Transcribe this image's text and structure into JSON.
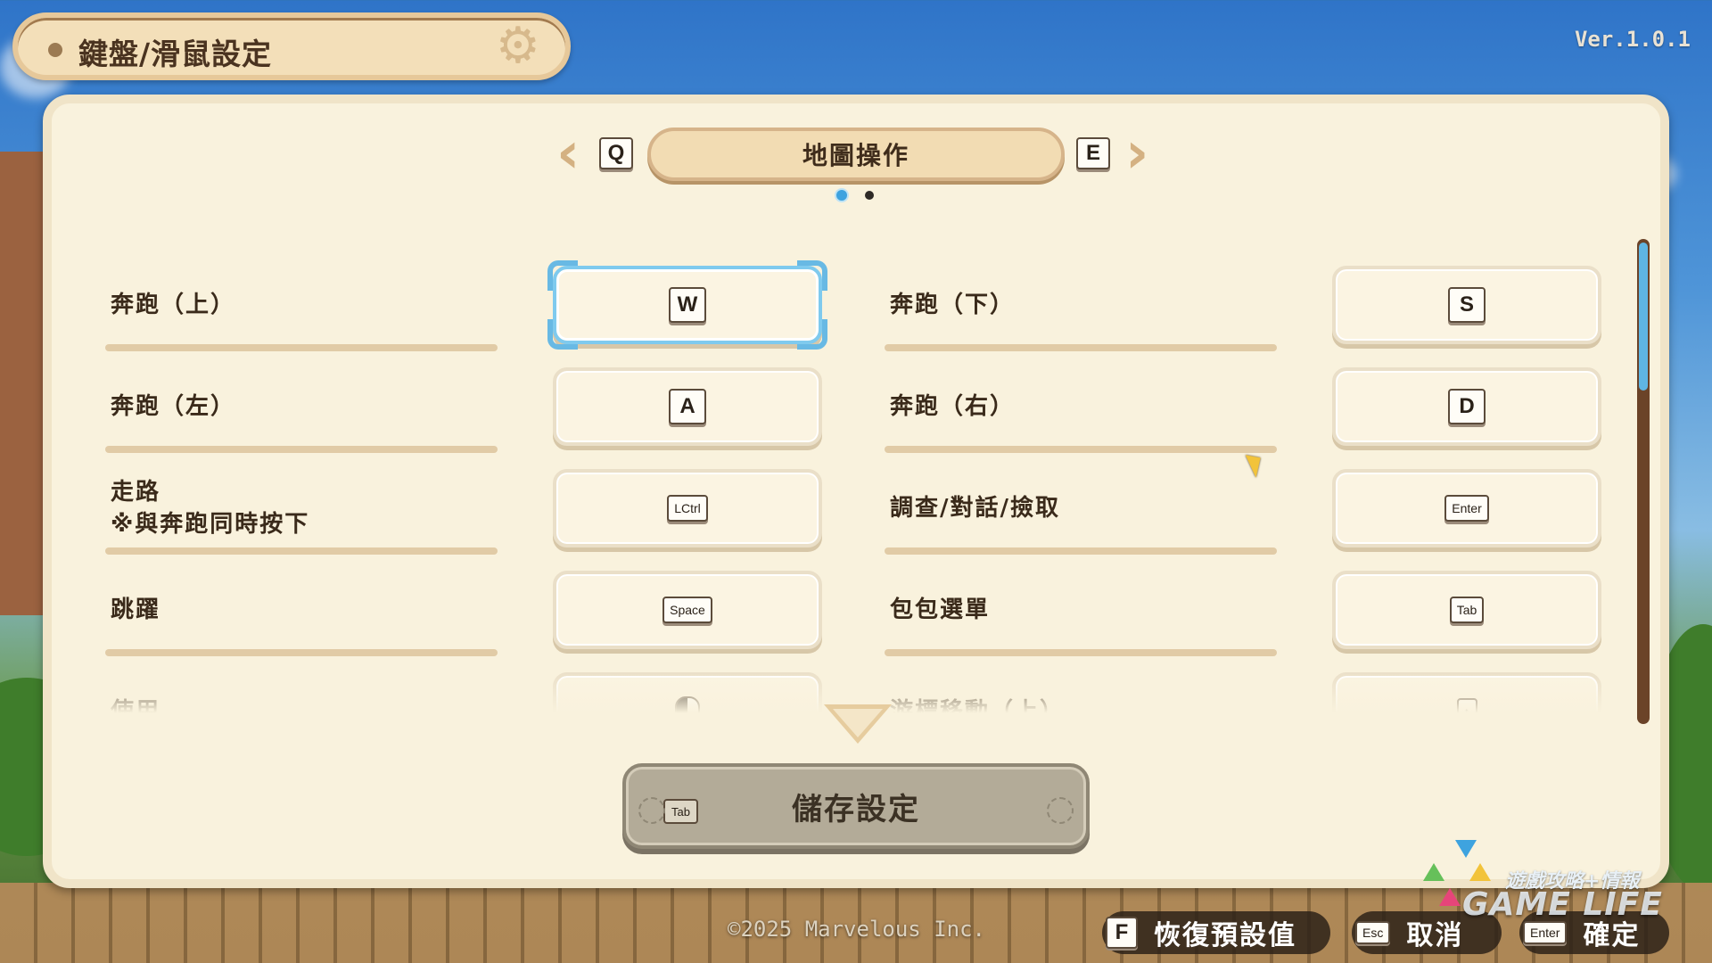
{
  "header": {
    "title": "鍵盤/滑鼠設定",
    "version": "Ver.1.0.1"
  },
  "category": {
    "prev_key": "Q",
    "next_key": "E",
    "label": "地圖操作",
    "page_index": 1,
    "page_count": 2
  },
  "bindings": [
    {
      "label": "奔跑（上）",
      "key": "W",
      "selected": true
    },
    {
      "label": "奔跑（下）",
      "key": "S"
    },
    {
      "label": "奔跑（左）",
      "key": "A"
    },
    {
      "label": "奔跑（右）",
      "key": "D"
    },
    {
      "label": "走路",
      "sublabel": "※與奔跑同時按下",
      "key": "LCtrl"
    },
    {
      "label": "調查/對話/撿取",
      "key": "Enter"
    },
    {
      "label": "跳躍",
      "key": "Space"
    },
    {
      "label": "包包選單",
      "key": "Tab"
    },
    {
      "label": "使用",
      "key_icon": "mouse-left-icon"
    },
    {
      "label": "游標移動（上）",
      "key": "↑"
    }
  ],
  "save": {
    "label": "儲存設定",
    "key": "Tab"
  },
  "footer": {
    "copyright": "©2025 Marvelous Inc.",
    "reset": {
      "key": "F",
      "label": "恢復預設值"
    },
    "cancel": {
      "key": "Esc",
      "label": "取消"
    },
    "confirm": {
      "key": "Enter",
      "label": "確定"
    }
  },
  "watermark": {
    "cn": "遊戲攻略+情報",
    "en": "GAME LIFE"
  },
  "colors": {
    "panel": "#f9f2dd",
    "selection": "#7fcaee",
    "scroll_thumb": "#5fb5e2"
  }
}
